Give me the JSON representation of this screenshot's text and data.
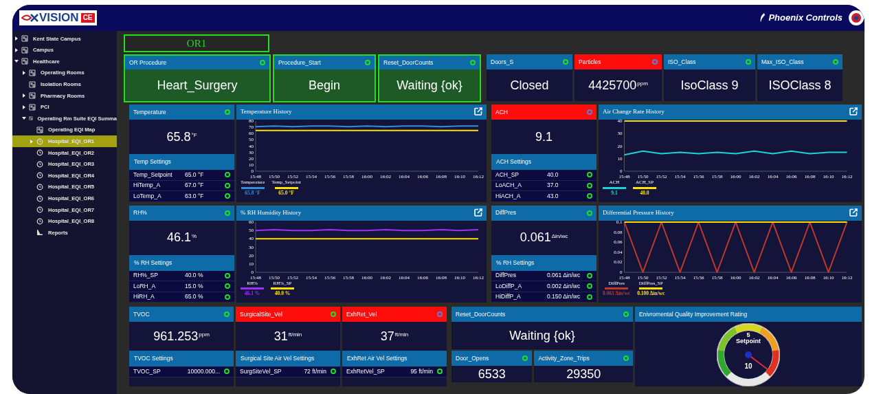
{
  "header": {
    "logo_text": "VISION",
    "logo_badge": "CE",
    "brand": "Phoenix Controls"
  },
  "sidebar": {
    "items": [
      {
        "label": "Kent State Campus",
        "kind": "site",
        "expanded": false,
        "selected": false
      },
      {
        "label": "Campus",
        "kind": "site",
        "expanded": false,
        "selected": false
      },
      {
        "label": "Healthcare",
        "kind": "site",
        "expanded": true,
        "selected": false,
        "children": [
          {
            "label": "Operating Rooms",
            "kind": "site",
            "expanded": false,
            "selected": false
          },
          {
            "label": "Isolation Rooms",
            "kind": "site",
            "selected": false
          },
          {
            "label": "Pharmacy Rooms",
            "kind": "site",
            "expanded": false,
            "selected": false
          },
          {
            "label": "PCI",
            "kind": "site",
            "expanded": false,
            "selected": false
          },
          {
            "label": "Operating Rm Suite EQI Summa",
            "kind": "site",
            "expanded": true,
            "selected": false,
            "children": [
              {
                "label": "Operating EQI Map",
                "kind": "site",
                "selected": false
              },
              {
                "label": "Hospital_EQI_OR1",
                "kind": "eqi",
                "expanded": false,
                "selected": true
              },
              {
                "label": "Hospital_EQI_OR2",
                "kind": "eqi",
                "selected": false
              },
              {
                "label": "Hospital_EQI_OR3",
                "kind": "eqi",
                "selected": false
              },
              {
                "label": "Hospital_EQI_OR4",
                "kind": "eqi",
                "selected": false
              },
              {
                "label": "Hospital_EQI_OR5",
                "kind": "eqi",
                "selected": false
              },
              {
                "label": "Hospital_EQI_OR6",
                "kind": "eqi",
                "selected": false
              },
              {
                "label": "Hospital_EQI_OR7",
                "kind": "eqi",
                "selected": false
              },
              {
                "label": "Hospital_EQI_OR8",
                "kind": "eqi",
                "selected": false
              },
              {
                "label": "Reports",
                "kind": "report",
                "selected": false
              }
            ]
          }
        ]
      }
    ]
  },
  "room_title": "OR1",
  "top_tiles": [
    {
      "title": "OR Procedure",
      "value": "Heart_Surgery",
      "ok": true,
      "alarm": false,
      "highlighted": true
    },
    {
      "title": "Procedure_Start",
      "value": "Begin",
      "ok": true,
      "alarm": false,
      "highlighted": true
    },
    {
      "title": "Reset_DoorCounts",
      "value": "Waiting {ok}",
      "ok": true,
      "alarm": false,
      "highlighted": true
    },
    {
      "title": "Doors_S",
      "value": "Closed",
      "ok": true,
      "alarm": false,
      "highlighted": false
    },
    {
      "title": "Particles",
      "value": "4425700",
      "unit": "ppm",
      "ok": false,
      "alarm": true,
      "highlighted": false
    },
    {
      "title": "ISO_Class",
      "value": "IsoClass 9",
      "ok": true,
      "alarm": false,
      "highlighted": false
    },
    {
      "title": "Max_ISO_Class",
      "value": "ISOClass 8",
      "ok": true,
      "alarm": false,
      "highlighted": false
    }
  ],
  "monitors": [
    {
      "sensor": {
        "title": "Temperature",
        "alarm": false,
        "ok": true,
        "value": "65.8",
        "unit": "°F",
        "settings_title": "Temp Settings",
        "settings": [
          {
            "name": "Temp_Setpoint",
            "value": "65.0 °F",
            "ok": true
          },
          {
            "name": "HiTemp_A",
            "value": "67.0 °F",
            "ok": true
          },
          {
            "name": "LoTemp_A",
            "value": "63.0 °F",
            "ok": true
          }
        ]
      },
      "history": {
        "title": "Temperature History",
        "legend_values": [
          "65.8 °F",
          "65.0 °F"
        ],
        "chart_data": {
          "type": "line",
          "categories": [
            "15:48",
            "15:50",
            "15:52",
            "15:54",
            "15:56",
            "15:58",
            "16:00",
            "16:02",
            "16:04",
            "16:06",
            "16:08",
            "16:10",
            "16:12"
          ],
          "ylim": [
            0,
            80
          ],
          "yticks": [
            0,
            10,
            20,
            30,
            40,
            50,
            60,
            70,
            80
          ],
          "series": [
            {
              "name": "Temperature",
              "color": "#2f8fd8",
              "values": [
                71,
                72,
                71,
                72,
                72,
                71,
                72,
                71,
                72,
                72,
                71,
                72,
                72
              ]
            },
            {
              "name": "Temp_Setpoint",
              "color": "#ffe000",
              "values": [
                65,
                65,
                65,
                65,
                65,
                65,
                65,
                65,
                65,
                65,
                65,
                65,
                65
              ]
            }
          ]
        }
      }
    },
    {
      "sensor": {
        "title": "ACH",
        "alarm": true,
        "ok": false,
        "value": "9.1",
        "settings_title": "ACH Settings",
        "settings": [
          {
            "name": "ACH_SP",
            "value": "40.0",
            "ok": true
          },
          {
            "name": "LoACH_A",
            "value": "37.0",
            "ok": true
          },
          {
            "name": "HiACH_A",
            "value": "43.0",
            "ok": true
          }
        ]
      },
      "history": {
        "title": "Air Change Rate History",
        "legend_values": [
          "9.1",
          "40.0"
        ],
        "chart_data": {
          "type": "line",
          "categories": [
            "15:48",
            "15:50",
            "15:52",
            "15:54",
            "15:56",
            "15:58",
            "16:00",
            "16:02",
            "16:04",
            "16:06",
            "16:08",
            "16:10",
            "16:12"
          ],
          "ylim": [
            0,
            40
          ],
          "yticks": [
            0,
            10,
            20,
            30,
            40
          ],
          "series": [
            {
              "name": "ACH",
              "color": "#19d6d6",
              "values": [
                13,
                16,
                14,
                15,
                14,
                15,
                14,
                16,
                14,
                16,
                14,
                15,
                15
              ]
            },
            {
              "name": "ACH_SP",
              "color": "#ffe000",
              "values": [
                40,
                40,
                40,
                40,
                40,
                40,
                40,
                40,
                40,
                40,
                40,
                40,
                40
              ]
            }
          ]
        }
      }
    },
    {
      "sensor": {
        "title": "RH%",
        "alarm": false,
        "ok": true,
        "value": "46.1",
        "unit": "%",
        "settings_title": "% RH Settings",
        "settings": [
          {
            "name": "RH%_SP",
            "value": "40.0 %",
            "ok": true
          },
          {
            "name": "LoRH_A",
            "value": "15.0 %",
            "ok": true
          },
          {
            "name": "HiRH_A",
            "value": "65.0 %",
            "ok": true
          }
        ]
      },
      "history": {
        "title": "% RH Humidity History",
        "legend_values": [
          "46.1 %",
          "40.0 %"
        ],
        "chart_data": {
          "type": "line",
          "categories": [
            "15:48",
            "15:50",
            "15:52",
            "15:54",
            "15:56",
            "15:58",
            "16:00",
            "16:02",
            "16:04",
            "16:06",
            "16:08",
            "16:10",
            "16:12"
          ],
          "ylim": [
            0,
            60
          ],
          "yticks": [
            0,
            10,
            20,
            30,
            40,
            50,
            60
          ],
          "series": [
            {
              "name": "RH%",
              "color": "#9b30ff",
              "values": [
                50,
                51,
                50,
                50,
                51,
                50,
                50,
                51,
                50,
                50,
                51,
                50,
                51
              ]
            },
            {
              "name": "RH%_SP",
              "color": "#ffe000",
              "values": [
                40,
                40,
                40,
                40,
                40,
                40,
                40,
                40,
                40,
                40,
                40,
                40,
                40
              ]
            }
          ]
        }
      }
    },
    {
      "sensor": {
        "title": "DiffPres",
        "alarm": false,
        "ok": true,
        "value": "0.061",
        "unit": "Δin/wc",
        "settings_title": "% RH Settings",
        "settings": [
          {
            "name": "DiffPres",
            "value": "0.061 Δin/wc",
            "ok": true
          },
          {
            "name": "LoDiffP_A",
            "value": "0.002 Δin/wc",
            "ok": true
          },
          {
            "name": "HiDiffP_A",
            "value": "0.150 Δin/wc",
            "ok": true
          }
        ]
      },
      "history": {
        "title": "Differential Pressure History",
        "legend_values": [
          "0.061 Δin/wc",
          "0.100 Δin/wc"
        ],
        "chart_data": {
          "type": "line",
          "categories": [
            "15:48",
            "15:50",
            "15:52",
            "15:54",
            "15:56",
            "15:58",
            "16:00",
            "16:02",
            "16:04",
            "16:06",
            "16:08",
            "16:10",
            "16:12"
          ],
          "ylim": [
            0,
            0.1
          ],
          "yticks": [
            0,
            0.02,
            0.04,
            0.06,
            0.08,
            0.1
          ],
          "series": [
            {
              "name": "DiffPres",
              "color": "#c0392b",
              "values": [
                0.1,
                0,
                0.1,
                0,
                0.1,
                0,
                0.1,
                0,
                0.1,
                0,
                0.1,
                0,
                0.1
              ]
            },
            {
              "name": "DiffPres_SP",
              "color": "#ffe000",
              "values": [
                0.1,
                0.1,
                0.1,
                0.1,
                0.1,
                0.1,
                0.1,
                0.1,
                0.1,
                0.1,
                0.1,
                0.1,
                0.1
              ]
            }
          ]
        }
      }
    }
  ],
  "bottom_sensors": [
    {
      "title": "TVOC",
      "alarm": false,
      "ok": true,
      "value": "961.253",
      "unit": "ppm",
      "settings_title": "TVOC Settings",
      "settings": [
        {
          "name": "TVOC_SP",
          "value": "10000.000...",
          "ok": true
        }
      ]
    },
    {
      "title": "SurgicalSite_Vel",
      "alarm": true,
      "ok": true,
      "value": "31",
      "unit": "ft/min",
      "settings_title": "Surgical Site Air Vel Settings",
      "settings": [
        {
          "name": "SurgSiteVel_SP",
          "value": "72 ft/min",
          "ok": true
        }
      ]
    },
    {
      "title": "ExhRet_Vel",
      "alarm": true,
      "ok": false,
      "value": "37",
      "unit": "ft/min",
      "settings_title": "ExhRet Air Vel Settings",
      "settings": [
        {
          "name": "ExhRetVel_SP",
          "value": "95 ft/min",
          "ok": true
        }
      ]
    }
  ],
  "door_panel": {
    "title": "Reset_DoorCounts",
    "ok": true,
    "value": "Waiting {ok}",
    "counters": [
      {
        "title": "Door_Opens",
        "ok": true,
        "value": "6533"
      },
      {
        "title": "Activity_Zone_Trips",
        "ok": true,
        "value": "29350"
      }
    ]
  },
  "rating": {
    "title": "Enivromental Quality Improvement Rating",
    "gauge": {
      "setpoint_value": "5",
      "setpoint_label": "Setpoint",
      "reading": "10"
    }
  }
}
